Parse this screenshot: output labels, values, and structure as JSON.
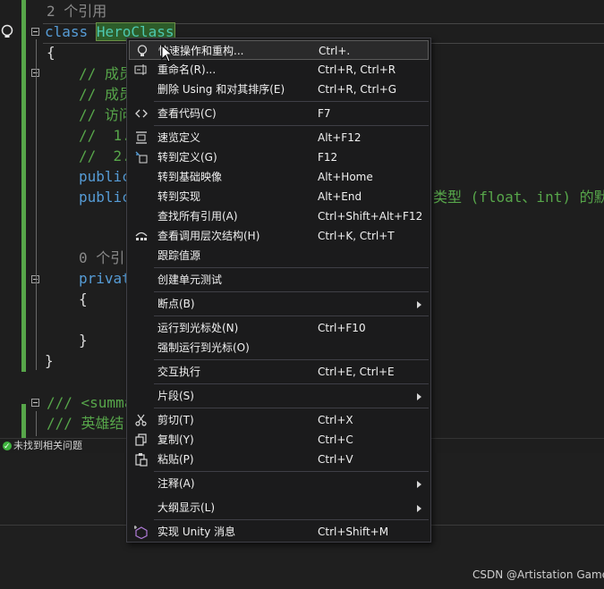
{
  "editor": {
    "lines": [
      {
        "ref_count": "2 个引用"
      },
      {
        "kw": "class",
        "name": "HeroClass"
      },
      {
        "text": "{"
      },
      {
        "text": "// 成员"
      },
      {
        "text": "// 成员"
      },
      {
        "text": "// 访问"
      },
      {
        "text": "//  1."
      },
      {
        "text": "//  2."
      },
      {
        "kw": "public"
      },
      {
        "kw": "public",
        "trail": "类型 (float、int) 的默"
      },
      {
        "ref_count": "0 个引"
      },
      {
        "kw": "privat"
      },
      {
        "text": "{"
      },
      {
        "text": "}"
      },
      {
        "text": "}"
      },
      {
        "text": "/// <summa"
      },
      {
        "text": "/// 英雄结"
      }
    ]
  },
  "status_bar": {
    "issues_text": "未找到相关问题",
    "issues_icon": "check-circle-icon"
  },
  "context_menu": {
    "items": [
      {
        "label": "快速操作和重构...",
        "shortcut": "Ctrl+.",
        "icon": "lightbulb-icon",
        "selected": true
      },
      {
        "label": "重命名(R)...",
        "shortcut": "Ctrl+R, Ctrl+R",
        "icon": "rename-icon"
      },
      {
        "label": "删除 Using 和对其排序(E)",
        "shortcut": "Ctrl+R, Ctrl+G"
      },
      {
        "label": "查看代码(C)",
        "shortcut": "F7",
        "icon": "code-brackets-icon"
      },
      {
        "label": "速览定义",
        "shortcut": "Alt+F12",
        "icon": "peek-definition-icon"
      },
      {
        "label": "转到定义(G)",
        "shortcut": "F12",
        "icon": "go-to-definition-icon"
      },
      {
        "label": "转到基础映像",
        "shortcut": "Alt+Home"
      },
      {
        "label": "转到实现",
        "shortcut": "Alt+End"
      },
      {
        "label": "查找所有引用(A)",
        "shortcut": "Ctrl+Shift+Alt+F12"
      },
      {
        "label": "查看调用层次结构(H)",
        "shortcut": "Ctrl+K, Ctrl+T",
        "icon": "call-hierarchy-icon"
      },
      {
        "label": "跟踪值源",
        "shortcut": ""
      },
      {
        "label": "创建单元测试",
        "shortcut": ""
      },
      {
        "label": "断点(B)",
        "shortcut": "",
        "submenu": true
      },
      {
        "label": "运行到光标处(N)",
        "shortcut": "Ctrl+F10"
      },
      {
        "label": "强制运行到光标(O)",
        "shortcut": ""
      },
      {
        "label": "交互执行",
        "shortcut": "Ctrl+E, Ctrl+E"
      },
      {
        "label": "片段(S)",
        "shortcut": "",
        "submenu": true
      },
      {
        "label": "剪切(T)",
        "shortcut": "Ctrl+X",
        "icon": "scissors-icon"
      },
      {
        "label": "复制(Y)",
        "shortcut": "Ctrl+C",
        "icon": "copy-icon"
      },
      {
        "label": "粘贴(P)",
        "shortcut": "Ctrl+V",
        "icon": "paste-icon"
      },
      {
        "label": "注释(A)",
        "shortcut": "",
        "submenu": true
      },
      {
        "label": "大纲显示(L)",
        "shortcut": "",
        "submenu": true
      },
      {
        "label": "实现 Unity 消息",
        "shortcut": "Ctrl+Shift+M",
        "icon": "unity-message-icon"
      }
    ]
  },
  "watermark": "CSDN @Artistation Game",
  "colors": {
    "comment": "#57a64a",
    "keyword": "#569cd6",
    "type": "#4ec9b0",
    "menu_bg": "#1b1b1c",
    "gutter_green": "#57a64a"
  }
}
